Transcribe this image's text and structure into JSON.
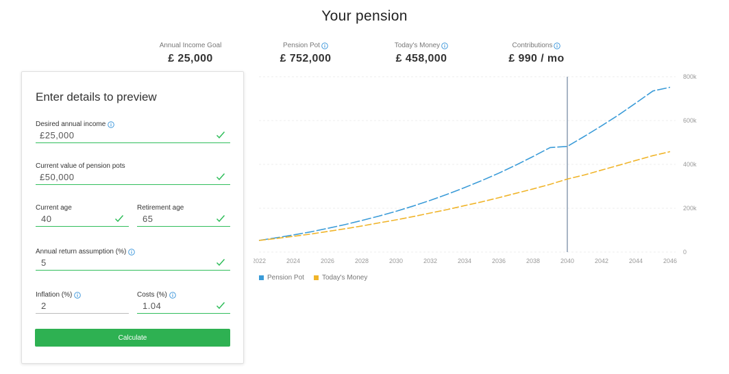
{
  "page": {
    "title": "Your pension"
  },
  "stats": [
    {
      "label": "Annual Income Goal",
      "value": "£ 25,000",
      "has_info": false
    },
    {
      "label": "Pension Pot",
      "value": "£ 752,000",
      "has_info": true
    },
    {
      "label": "Today's Money",
      "value": "£ 458,000",
      "has_info": true
    },
    {
      "label": "Contributions",
      "value": "£ 990 / mo",
      "has_info": true
    }
  ],
  "form": {
    "title": "Enter details to preview",
    "desired_income": {
      "label": "Desired annual income",
      "value": "£25,000"
    },
    "pension_value": {
      "label": "Current value of pension pots",
      "value": "£50,000"
    },
    "current_age": {
      "label": "Current age",
      "value": "40"
    },
    "retirement_age": {
      "label": "Retirement age",
      "value": "65"
    },
    "annual_return": {
      "label": "Annual return assumption (%)",
      "value": "5"
    },
    "inflation": {
      "label": "Inflation (%)",
      "value": "2"
    },
    "costs": {
      "label": "Costs (%)",
      "value": "1.04"
    },
    "button_label": "Calculate"
  },
  "colors": {
    "pension_pot": "#3a9bd8",
    "todays_money": "#f0b429",
    "valid": "#2ebd59",
    "info": "#2f8fd8",
    "marker": "#8a9bb0"
  },
  "chart_data": {
    "type": "line",
    "x": [
      2022,
      2023,
      2024,
      2025,
      2026,
      2027,
      2028,
      2029,
      2030,
      2031,
      2032,
      2033,
      2034,
      2035,
      2036,
      2037,
      2038,
      2039,
      2040,
      2041,
      2042,
      2043,
      2044,
      2045,
      2046
    ],
    "x_ticks": [
      "2022",
      "2024",
      "2026",
      "2028",
      "2030",
      "2032",
      "2034",
      "2036",
      "2038",
      "2040",
      "2042",
      "2044",
      "2046"
    ],
    "y_ticks": [
      "0",
      "200k",
      "400k",
      "600k",
      "800k"
    ],
    "ylim": [
      0,
      800000
    ],
    "xlim": [
      2022,
      2046
    ],
    "marker_x": 2040,
    "grid": true,
    "legend_position": "bottom-left",
    "series": [
      {
        "name": "Pension Pot",
        "values": [
          53000,
          65000,
          78000,
          92000,
          108000,
          125000,
          144000,
          164000,
          186000,
          210000,
          236000,
          264000,
          294000,
          326000,
          360000,
          397000,
          436000,
          477000,
          482000,
          528000,
          576000,
          626000,
          680000,
          735000,
          752000
        ]
      },
      {
        "name": "Today's Money",
        "values": [
          53000,
          62000,
          72000,
          82000,
          94000,
          106000,
          119000,
          133000,
          147000,
          162000,
          178000,
          194000,
          212000,
          229000,
          248000,
          268000,
          288000,
          309000,
          333000,
          352000,
          374000,
          396000,
          418000,
          440000,
          458000
        ]
      }
    ]
  }
}
